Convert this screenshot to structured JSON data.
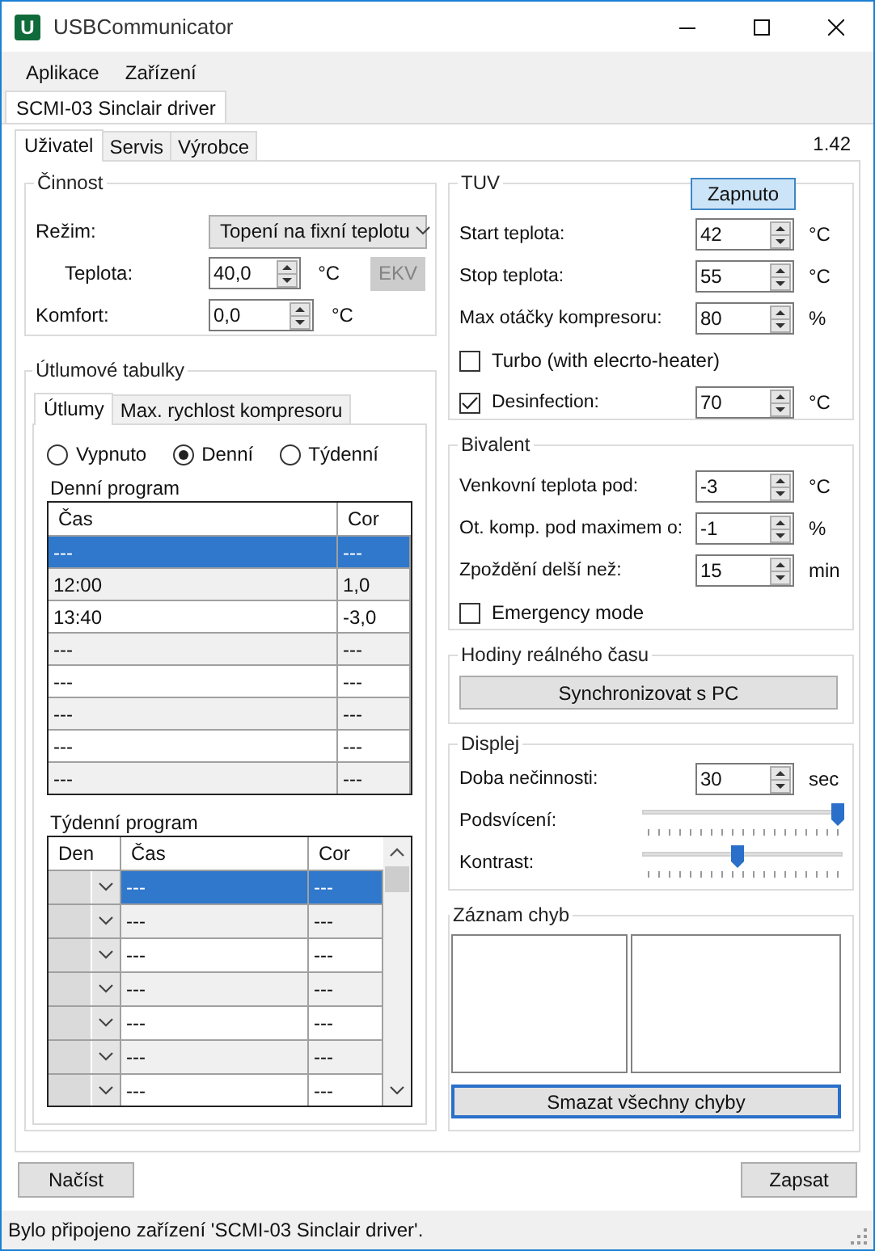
{
  "window": {
    "title": "USBCommunicator",
    "icon_letter": "U"
  },
  "menu": [
    "Aplikace",
    "Zařízení"
  ],
  "document_tabs": [
    {
      "label": "SCMI-03 Sinclair driver",
      "selected": true
    }
  ],
  "tabs": [
    {
      "label": "Uživatel",
      "selected": true
    },
    {
      "label": "Servis",
      "selected": false
    },
    {
      "label": "Výrobce",
      "selected": false
    }
  ],
  "version": "1.42",
  "cinnost": {
    "title": "Činnost",
    "rows": [
      {
        "kind": "combo",
        "label": "Režim:",
        "value": "Topení na fixní teplotu"
      },
      {
        "kind": "spin",
        "label": "Teplota:",
        "indent": true,
        "value": "40,0",
        "unit": "°C",
        "button": {
          "label": "EKV",
          "disabled": true
        }
      },
      {
        "kind": "spin",
        "label": "Komfort:",
        "value": "0,0",
        "unit": "°C"
      }
    ]
  },
  "utlumove_tabulky": {
    "title": "Útlumové tabulky",
    "tabs": [
      {
        "label": "Útlumy",
        "selected": true
      },
      {
        "label": "Max. rychlost kompresoru",
        "selected": false
      }
    ],
    "modes": [
      {
        "label": "Vypnuto",
        "selected": false
      },
      {
        "label": "Denní",
        "selected": true
      },
      {
        "label": "Týdenní",
        "selected": false
      }
    ],
    "daily": {
      "title": "Denní program",
      "columns": [
        "Čas",
        "Cor"
      ],
      "rows": [
        {
          "cells": [
            "---",
            "---"
          ],
          "selected": true
        },
        {
          "cells": [
            "12:00",
            "1,0"
          ],
          "selected": false
        },
        {
          "cells": [
            "13:40",
            "-3,0"
          ],
          "selected": false
        },
        {
          "cells": [
            "---",
            "---"
          ],
          "selected": false
        },
        {
          "cells": [
            "---",
            "---"
          ],
          "selected": false
        },
        {
          "cells": [
            "---",
            "---"
          ],
          "selected": false
        },
        {
          "cells": [
            "---",
            "---"
          ],
          "selected": false
        },
        {
          "cells": [
            "---",
            "---"
          ],
          "selected": false
        }
      ]
    },
    "weekly": {
      "title": "Týdenní program",
      "columns": [
        "Den",
        "Čas",
        "Cor"
      ],
      "rows": [
        {
          "cells": [
            "",
            "---",
            "---"
          ],
          "selected": true
        },
        {
          "cells": [
            "",
            "---",
            "---"
          ],
          "selected": false
        },
        {
          "cells": [
            "",
            "---",
            "---"
          ],
          "selected": false
        },
        {
          "cells": [
            "",
            "---",
            "---"
          ],
          "selected": false
        },
        {
          "cells": [
            "",
            "---",
            "---"
          ],
          "selected": false
        },
        {
          "cells": [
            "",
            "---",
            "---"
          ],
          "selected": false
        },
        {
          "cells": [
            "",
            "---",
            "---"
          ],
          "selected": false
        }
      ]
    }
  },
  "tuv": {
    "title": "TUV",
    "toggle": {
      "label": "Zapnuto",
      "on": true
    },
    "rows": [
      {
        "kind": "spin",
        "label": "Start teplota:",
        "value": "42",
        "unit": "°C"
      },
      {
        "kind": "spin",
        "label": "Stop teplota:",
        "value": "55",
        "unit": "°C"
      },
      {
        "kind": "spin",
        "label": "Max otáčky kompresoru:",
        "value": "80",
        "unit": "%"
      },
      {
        "kind": "check",
        "label": "Turbo (with elecrto-heater)",
        "checked": false
      },
      {
        "kind": "check_spin",
        "label": "Desinfection:",
        "checked": true,
        "value": "70",
        "unit": "°C"
      }
    ]
  },
  "bivalent": {
    "title": "Bivalent",
    "rows": [
      {
        "kind": "spin",
        "label": "Venkovní teplota pod:",
        "value": "-3",
        "unit": "°C"
      },
      {
        "kind": "spin",
        "label": "Ot. komp. pod maximem o:",
        "value": "-1",
        "unit": "%"
      },
      {
        "kind": "spin",
        "label": "Zpoždění delší než:",
        "value": "15",
        "unit": "min"
      },
      {
        "kind": "check",
        "label": "Emergency mode",
        "checked": false
      }
    ]
  },
  "hodiny": {
    "title": "Hodiny reálného času",
    "button": "Synchronizovat s PC"
  },
  "displej": {
    "title": "Displej",
    "rows": [
      {
        "kind": "spin",
        "label": "Doba nečinnosti:",
        "value": "30",
        "unit": "sec"
      },
      {
        "kind": "slider",
        "label": "Podsvícení:",
        "level": 1.0
      },
      {
        "kind": "slider",
        "label": "Kontrast:",
        "level": 0.47
      }
    ]
  },
  "zaznam_chyb": {
    "title": "Záznam chyb",
    "button": {
      "label": "Smazat všechny chyby",
      "focused": true
    }
  },
  "buttons": {
    "load": "Načíst",
    "save": "Zapsat"
  },
  "status_bar": "Bylo připojeno zařízení 'SCMI-03 Sinclair driver'."
}
